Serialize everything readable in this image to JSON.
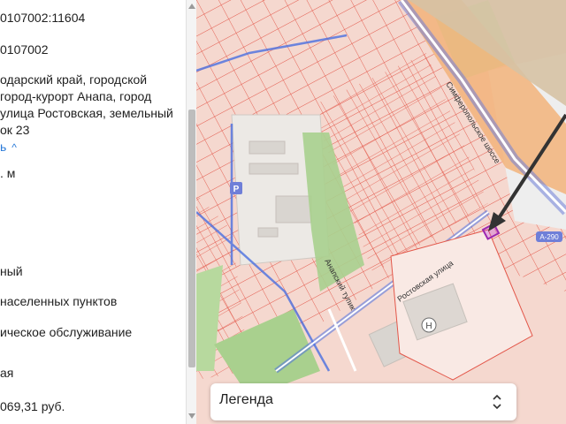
{
  "info_panel": {
    "lines": [
      "0107002:11604",
      "0107002",
      "одарский край, городской",
      "город-курорт Анапа, город",
      "улица Ростовская, земельный",
      "ок 23",
      "ь",
      ". м",
      "ный",
      "населенных пунктов",
      "ическое обслуживание",
      "ая",
      "069,31 руб."
    ]
  },
  "map": {
    "street_labels": [
      "Симферопольское шоссе",
      "Ростовская улица",
      "Анапский тупик"
    ],
    "road_badge": "А-290",
    "parking_label": "P",
    "poi_label": "H"
  },
  "legend": {
    "label": "Легенда"
  }
}
